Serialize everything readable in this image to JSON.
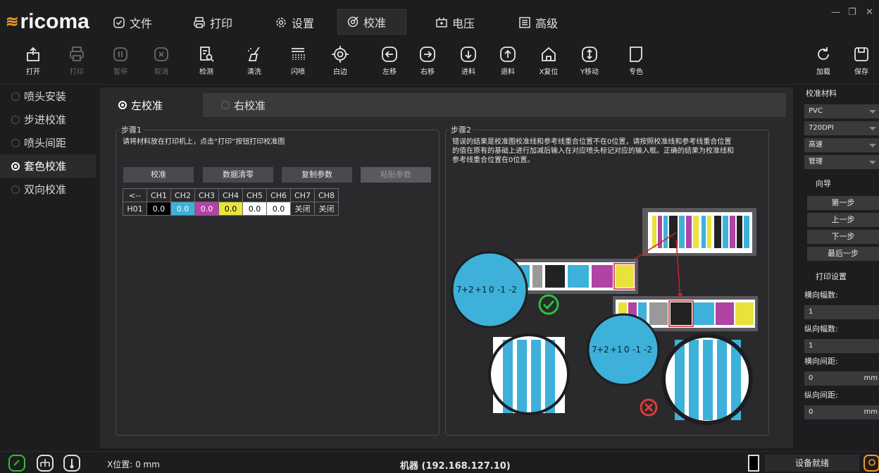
{
  "app": {
    "logo": "ricoma"
  },
  "menu": [
    {
      "label": "文件",
      "icon": "file-check-icon"
    },
    {
      "label": "打印",
      "icon": "printer-icon"
    },
    {
      "label": "设置",
      "icon": "gear-icon"
    },
    {
      "label": "校准",
      "icon": "calibrate-icon"
    },
    {
      "label": "电压",
      "icon": "voltage-icon"
    },
    {
      "label": "高级",
      "icon": "advanced-icon"
    }
  ],
  "toolbar": {
    "open": "打开",
    "print": "打印",
    "pause": "暂停",
    "cancel": "取消",
    "detect": "检测",
    "clean": "清洗",
    "flash": "闪喷",
    "white_edge": "白边",
    "move_left": "左移",
    "move_right": "右移",
    "feed": "进料",
    "retract": "退料",
    "x_reset": "X复位",
    "y_move": "Y移动",
    "spot_color": "专色",
    "load": "加载",
    "save": "保存"
  },
  "sidebar": {
    "items": [
      {
        "label": "喷头安装"
      },
      {
        "label": "步进校准"
      },
      {
        "label": "喷头间距"
      },
      {
        "label": "套色校准"
      },
      {
        "label": "双向校准"
      }
    ]
  },
  "tabs": {
    "left": "左校准",
    "right": "右校准"
  },
  "step1": {
    "legend": "步骤1",
    "desc": "请将材料放在打印机上，点击“打印”按钮打印校准图",
    "btn_calibrate": "校准",
    "btn_clear": "数据清零",
    "btn_copy": "复制参数",
    "btn_paste": "粘贴参数",
    "table": {
      "headers": [
        "<--",
        "CH1",
        "CH2",
        "CH3",
        "CH4",
        "CH5",
        "CH6",
        "CH7",
        "CH8"
      ],
      "row": [
        "H01",
        "0.0",
        "0.0",
        "0.0",
        "0.0",
        "0.0",
        "0.0",
        "关闭",
        "关闭"
      ]
    }
  },
  "step2": {
    "legend": "步骤2",
    "desc_lines": [
      "错误的结果是校准图校准线和参考线重合位置不在0位置，请按照校准线和参考线重合位置",
      "的值在原有的基础上进行加减后输入在对应喷头标记对应的输入框。正确的结果为校准线和",
      "参考线重合位置在0位置。"
    ],
    "scale_labels": [
      "+2",
      "+1",
      "0",
      "-1",
      "-2"
    ]
  },
  "right_panel": {
    "material_legend": "校准材料",
    "material": "PVC",
    "dpi": "720DPI",
    "speed": "高速",
    "manage": "管理",
    "guide_legend": "向导",
    "first": "第一步",
    "prev": "上一步",
    "next": "下一步",
    "last": "最后一步",
    "print_legend": "打印设置",
    "h_count_label": "横向幅数:",
    "h_count": "1",
    "v_count_label": "纵向幅数:",
    "v_count": "1",
    "h_gap_label": "横向间距:",
    "h_gap": "0",
    "h_gap_unit": "mm",
    "v_gap_label": "纵向间距:",
    "v_gap": "0",
    "v_gap_unit": "mm"
  },
  "status": {
    "x_pos": "X位置: 0 mm",
    "machine": "机器 (192.168.127.10)",
    "ready": "设备就绪"
  },
  "colors": {
    "cyan": "#3db1d9",
    "magenta": "#b143a4",
    "yellow": "#e8e33c",
    "ok": "#2dbf3c",
    "err": "#e03a3a",
    "accent": "#f29a2e"
  }
}
